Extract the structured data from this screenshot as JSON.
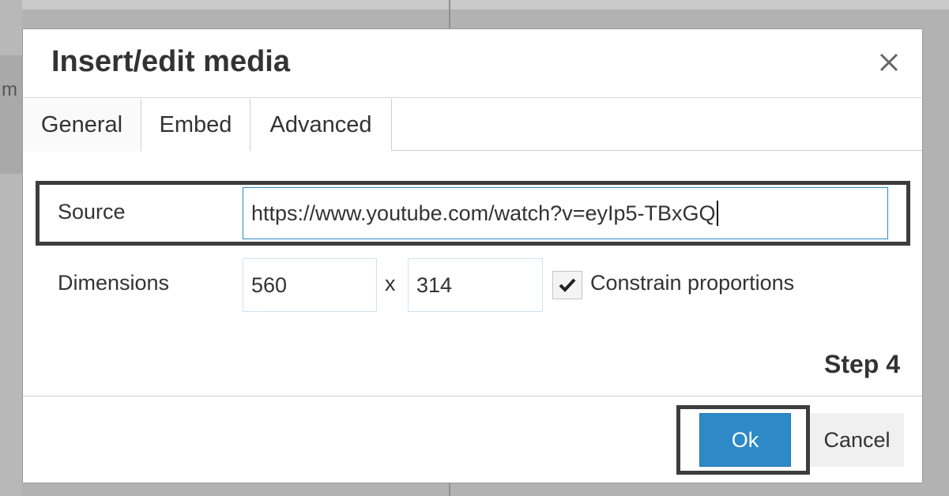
{
  "background": {
    "partial_text": "m"
  },
  "dialog": {
    "title": "Insert/edit media",
    "close_icon": "close-icon"
  },
  "tabs": [
    {
      "label": "General",
      "active": true
    },
    {
      "label": "Embed",
      "active": false
    },
    {
      "label": "Advanced",
      "active": false
    }
  ],
  "form": {
    "source": {
      "label": "Source",
      "value": "https://www.youtube.com/watch?v=eyIp5-TBxGQ"
    },
    "dimensions": {
      "label": "Dimensions",
      "width": "560",
      "separator": "x",
      "height": "314",
      "constrain_label": "Constrain proportions",
      "constrain_checked": true,
      "check_icon": "checkmark-icon"
    }
  },
  "annotation": {
    "step_label": "Step 4"
  },
  "footer": {
    "ok_label": "Ok",
    "cancel_label": "Cancel"
  },
  "colors": {
    "accent": "#2d8ac7",
    "highlight_border": "#3d3d3d",
    "backdrop": "#b2b2b2"
  }
}
